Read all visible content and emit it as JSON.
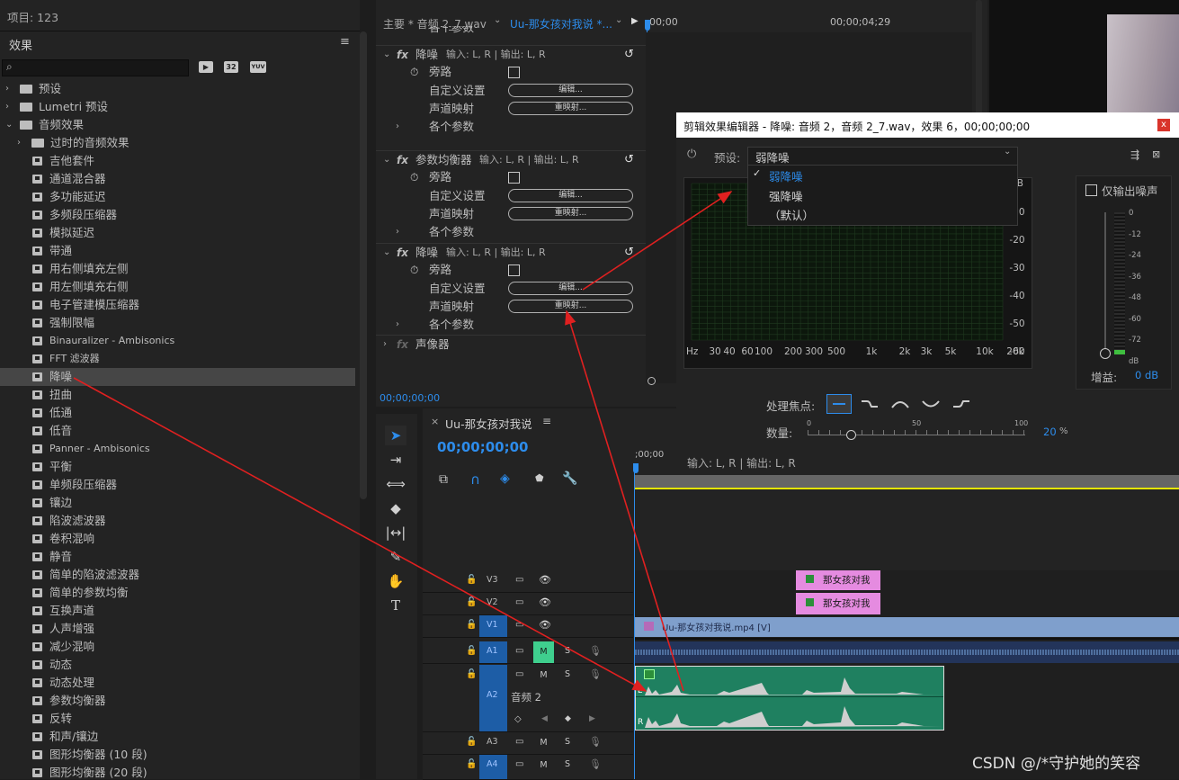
{
  "project": {
    "label": "项目: 123"
  },
  "effects": {
    "title": "效果",
    "search_placeholder": "",
    "filter_icons": [
      "32",
      "YUV"
    ],
    "tree": [
      {
        "label": "预设",
        "level": 0,
        "type": "folder",
        "expanded": false
      },
      {
        "label": "Lumetri 预设",
        "level": 0,
        "type": "folder",
        "expanded": false
      },
      {
        "label": "音频效果",
        "level": 0,
        "type": "folder",
        "expanded": true
      },
      {
        "label": "过时的音频效果",
        "level": 1,
        "type": "folder",
        "expanded": false
      },
      {
        "label": "吉他套件",
        "level": 2,
        "type": "effect"
      },
      {
        "label": "通道混合器",
        "level": 2,
        "type": "effect"
      },
      {
        "label": "多功能延迟",
        "level": 2,
        "type": "effect"
      },
      {
        "label": "多频段压缩器",
        "level": 2,
        "type": "effect"
      },
      {
        "label": "模拟延迟",
        "level": 2,
        "type": "effect"
      },
      {
        "label": "带通",
        "level": 2,
        "type": "effect"
      },
      {
        "label": "用右侧填充左侧",
        "level": 2,
        "type": "effect"
      },
      {
        "label": "用左侧填充右侧",
        "level": 2,
        "type": "effect"
      },
      {
        "label": "电子管建模压缩器",
        "level": 2,
        "type": "effect"
      },
      {
        "label": "强制限幅",
        "level": 2,
        "type": "effect"
      },
      {
        "label": "Binauralizer - Ambisonics",
        "level": 2,
        "type": "effect"
      },
      {
        "label": "FFT 滤波器",
        "level": 2,
        "type": "effect"
      },
      {
        "label": "降噪",
        "level": 2,
        "type": "effect",
        "selected": true
      },
      {
        "label": "扭曲",
        "level": 2,
        "type": "effect"
      },
      {
        "label": "低通",
        "level": 2,
        "type": "effect"
      },
      {
        "label": "低音",
        "level": 2,
        "type": "effect"
      },
      {
        "label": "Panner - Ambisonics",
        "level": 2,
        "type": "effect"
      },
      {
        "label": "平衡",
        "level": 2,
        "type": "effect"
      },
      {
        "label": "单频段压缩器",
        "level": 2,
        "type": "effect"
      },
      {
        "label": "镶边",
        "level": 2,
        "type": "effect"
      },
      {
        "label": "陷波滤波器",
        "level": 2,
        "type": "effect"
      },
      {
        "label": "卷积混响",
        "level": 2,
        "type": "effect"
      },
      {
        "label": "静音",
        "level": 2,
        "type": "effect"
      },
      {
        "label": "简单的陷波滤波器",
        "level": 2,
        "type": "effect"
      },
      {
        "label": "简单的参数均衡",
        "level": 2,
        "type": "effect"
      },
      {
        "label": "互换声道",
        "level": 2,
        "type": "effect"
      },
      {
        "label": "人声增强",
        "level": 2,
        "type": "effect"
      },
      {
        "label": "减少混响",
        "level": 2,
        "type": "effect"
      },
      {
        "label": "动态",
        "level": 2,
        "type": "effect"
      },
      {
        "label": "动态处理",
        "level": 2,
        "type": "effect"
      },
      {
        "label": "参数均衡器",
        "level": 2,
        "type": "effect"
      },
      {
        "label": "反转",
        "level": 2,
        "type": "effect"
      },
      {
        "label": "和声/镶边",
        "level": 2,
        "type": "effect"
      },
      {
        "label": "图形均衡器 (10 段)",
        "level": 2,
        "type": "effect"
      },
      {
        "label": "图形均衡器 (20 段)",
        "level": 2,
        "type": "effect"
      }
    ]
  },
  "effect_controls": {
    "tab_master": "主要 * 音频 2_7.wav",
    "tab_clip": "Uu-那女孩对我说 *...",
    "time_start": "00;00",
    "time_end": "00;00;04;29",
    "partial_top": "各个参数",
    "groups": [
      {
        "name": "降噪",
        "io": "输入: L, R | 输出: L, R",
        "bypass": "旁路",
        "custom": "自定义设置",
        "edit": "编辑...",
        "map": "声道映射",
        "remap": "重映射...",
        "params": "各个参数"
      },
      {
        "name": "参数均衡器",
        "io": "输入: L, R | 输出: L, R",
        "bypass": "旁路",
        "custom": "自定义设置",
        "edit": "编辑...",
        "map": "声道映射",
        "remap": "重映射...",
        "params": "各个参数"
      },
      {
        "name": "降噪",
        "io": "输入: L, R | 输出: L, R",
        "bypass": "旁路",
        "custom": "自定义设置",
        "edit": "编辑...",
        "map": "声道映射",
        "remap": "重映射...",
        "params": "各个参数"
      }
    ],
    "panner": "声像器",
    "timecode": "00;00;00;00"
  },
  "dialog": {
    "title": "剪辑效果编辑器 - 降噪: 音频 2，音频 2_7.wav，效果 6，00;00;00;00",
    "preset_label": "预设:",
    "preset_value": "弱降噪",
    "preset_options": [
      "弱降噪",
      "强降噪",
      "（默认）"
    ],
    "db_label": "dB",
    "db_ticks": [
      "-10",
      "-20",
      "-30",
      "-40",
      "-50",
      "-60"
    ],
    "hz_label": "Hz",
    "hz_ticks": [
      "30",
      "40",
      "60",
      "100",
      "200",
      "300",
      "500",
      "1k",
      "2k",
      "3k",
      "5k",
      "10k",
      "20k"
    ],
    "output_noise_only": "仅输出噪声",
    "meter_ticks": [
      "0",
      "-12",
      "-24",
      "-36",
      "-48",
      "-60",
      "-72",
      "dB"
    ],
    "gain_label": "增益:",
    "gain_value": "0 dB",
    "focus_label": "处理焦点:",
    "amount_label": "数量:",
    "amount_ticks": [
      "0",
      "50",
      "100"
    ],
    "amount_value": "20",
    "amount_unit": "%",
    "amount_fraction": 0.2,
    "io": "输入: L, R | 输出: L, R",
    "close": "x"
  },
  "timeline": {
    "sequence": "Uu-那女孩对我说",
    "timecode": "00;00;00;00",
    "ruler_start": ";00;00",
    "tracks": [
      {
        "id": "V3",
        "lock": true
      },
      {
        "id": "V2"
      },
      {
        "id": "V1",
        "target": true
      },
      {
        "id": "A1",
        "target": true,
        "m_on": true
      },
      {
        "id": "A2",
        "target": true,
        "name": "音频 2"
      },
      {
        "id": "A3"
      },
      {
        "id": "A4",
        "target": true
      }
    ],
    "btn_m": "M",
    "btn_s": "S",
    "clips": {
      "v3": "那女孩对我",
      "v2": "那女孩对我",
      "v1": "Uu-那女孩对我说.mp4 [V]",
      "a2_l": "L",
      "a2_r": "R"
    }
  },
  "watermark": "CSDN @/*守护她的笑容",
  "colors": {
    "accent": "#2d8ceb",
    "arrow": "#e02020",
    "clip_pink": "#e58be0",
    "clip_green": "#1f8060",
    "clip_blue": "#7f9fcc",
    "playhead": "#2d8ceb"
  }
}
